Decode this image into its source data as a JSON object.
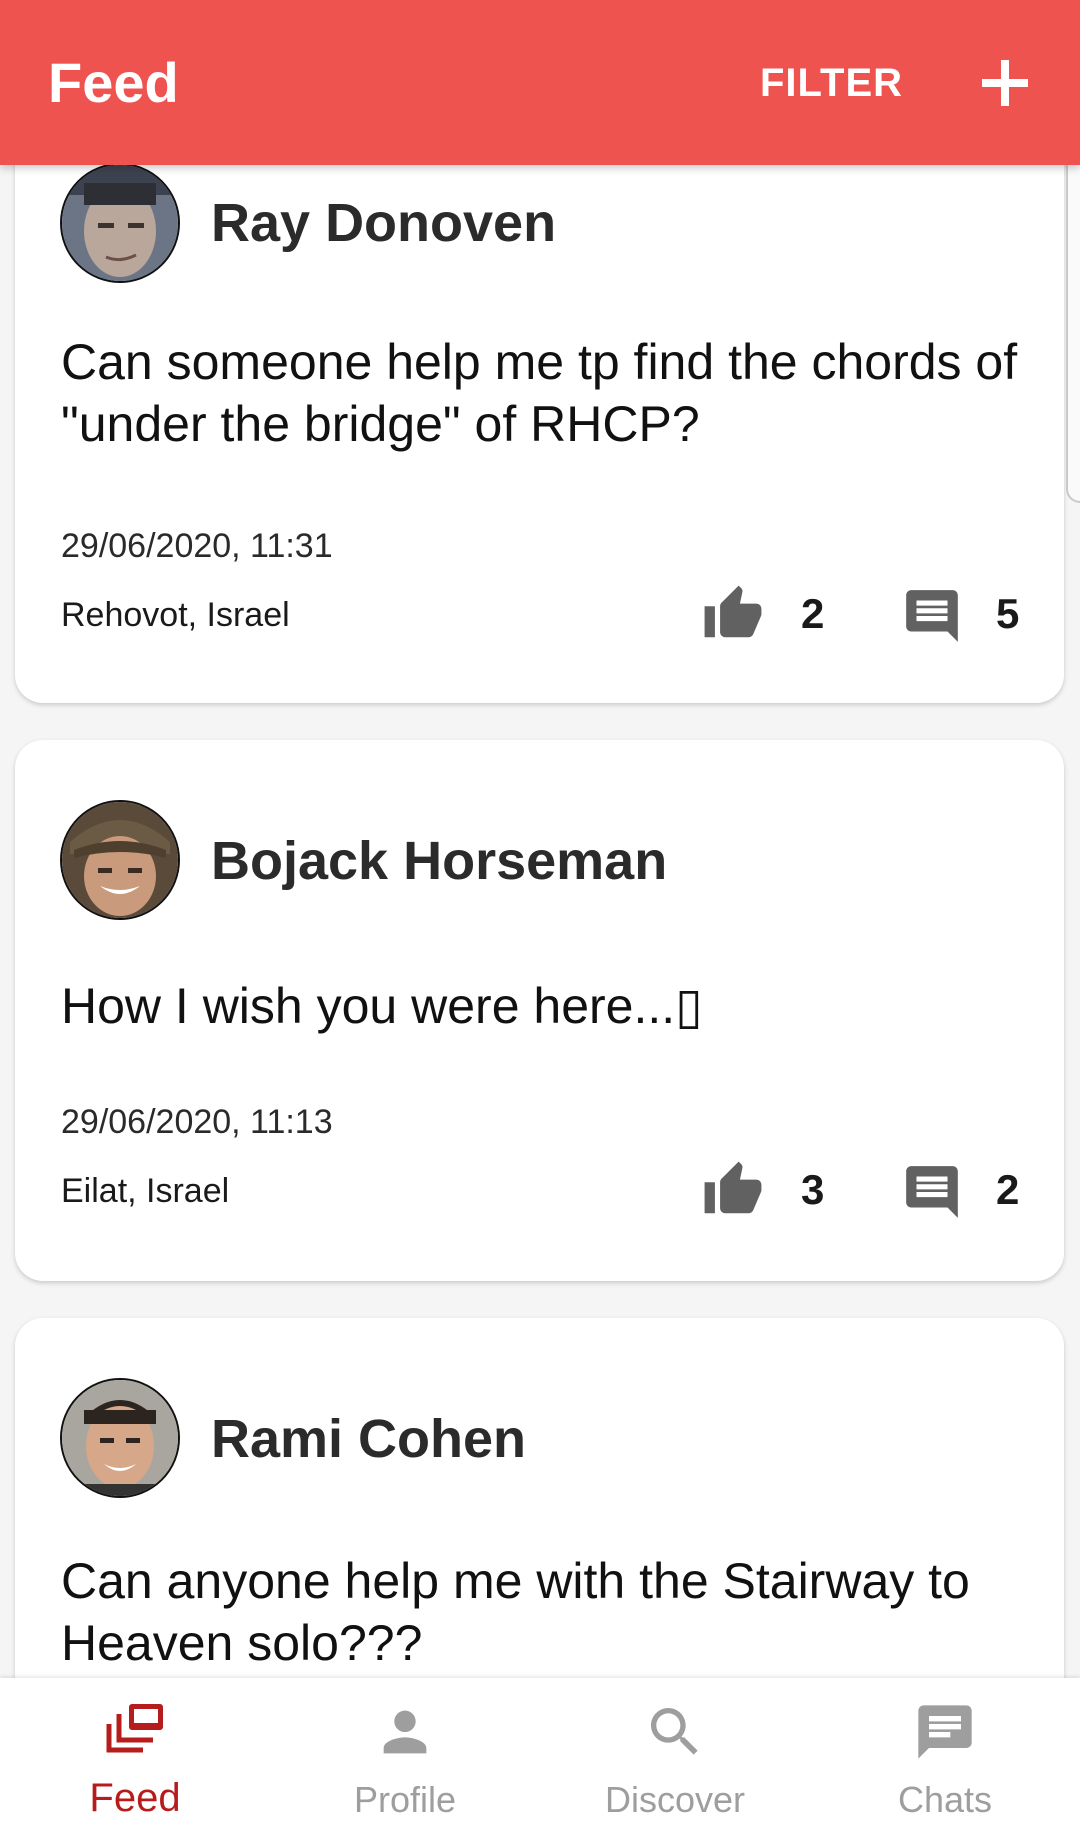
{
  "header": {
    "title": "Feed",
    "filter_label": "FILTER",
    "add_icon": "plus-icon"
  },
  "posts": [
    {
      "author": "Ray Donoven",
      "text": "Can someone help me tp find the chords of \"under the bridge\" of RHCP?",
      "date": "29/06/2020, 11:31",
      "location": "Rehovot, Israel",
      "likes": "2",
      "comments": "5"
    },
    {
      "author": "Bojack Horseman",
      "text": "How I wish you were here...▯",
      "date": "29/06/2020, 11:13",
      "location": "Eilat, Israel",
      "likes": "3",
      "comments": "2"
    },
    {
      "author": "Rami Cohen",
      "text": "Can anyone help me with the Stairway to Heaven solo???"
    }
  ],
  "bottom_nav": {
    "items": [
      {
        "label": "Feed",
        "icon": "feed-icon",
        "active": true
      },
      {
        "label": "Profile",
        "icon": "person-icon",
        "active": false
      },
      {
        "label": "Discover",
        "icon": "search-icon",
        "active": false
      },
      {
        "label": "Chats",
        "icon": "chat-icon",
        "active": false
      }
    ]
  },
  "colors": {
    "app_bar": "#ef5350",
    "active_nav": "#b71c1c",
    "inactive_nav": "#9e9e9e",
    "action_icon": "#616161"
  }
}
